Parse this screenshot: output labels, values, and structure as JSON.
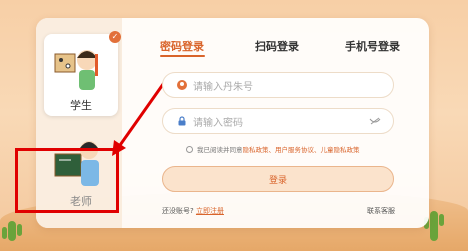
{
  "tabs": [
    {
      "label": "密码登录",
      "active": true
    },
    {
      "label": "扫码登录",
      "active": false
    },
    {
      "label": "手机号登录",
      "active": false
    }
  ],
  "roles": {
    "student_label": "学生",
    "teacher_label": "老师"
  },
  "form": {
    "account_placeholder": "请输入丹朱号",
    "password_placeholder": "请输入密码",
    "agree_prefix": "我已阅读并同意",
    "agree_links": "隐私政策、用户服务协议、儿童隐私政策",
    "login_label": "登录"
  },
  "footer": {
    "no_account": "还没账号?",
    "register": "立即注册",
    "contact": "联系客服"
  },
  "colors": {
    "accent": "#d9642b",
    "highlight": "#e00000"
  },
  "icons": [
    "check-icon",
    "user-icon",
    "lock-icon",
    "eye-closed-icon",
    "arrow-icon"
  ]
}
